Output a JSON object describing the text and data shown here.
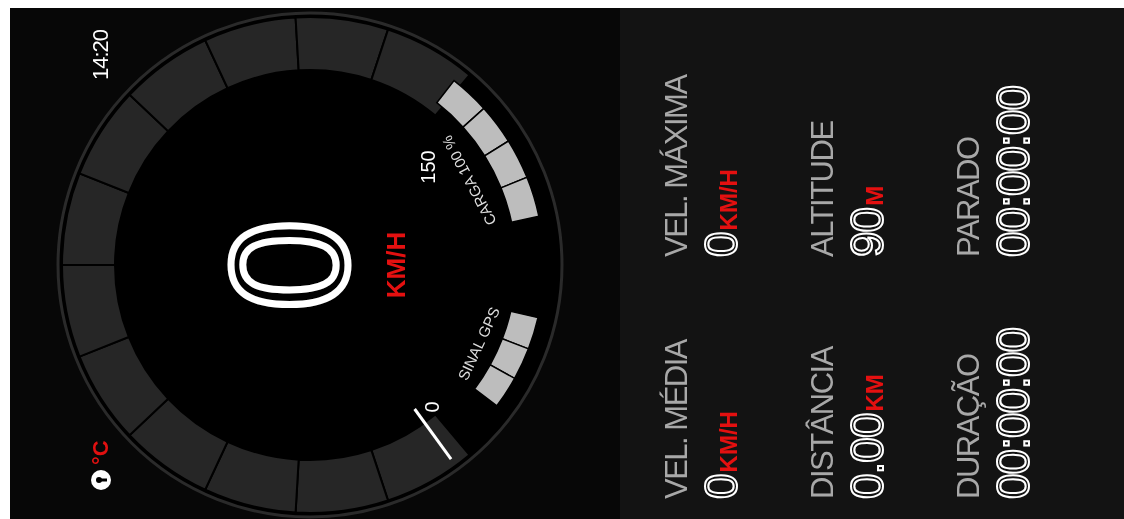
{
  "status_bar": {
    "temperature_unit": "°C",
    "time": "14:20"
  },
  "gauge": {
    "speed": "0",
    "unit": "KM/H",
    "scale_min": "0",
    "scale_max": "150",
    "indicators": [
      {
        "label": "CARGA 100 %"
      },
      {
        "label": "SINAL GPS"
      }
    ]
  },
  "stats": [
    {
      "label": "VEL. MÉDIA",
      "value": "0",
      "unit": "KM/H"
    },
    {
      "label": "VEL. MÁXIMA",
      "value": "0",
      "unit": "KM/H"
    },
    {
      "label": "DISTÂNCIA",
      "value": "0.00",
      "unit": "KM"
    },
    {
      "label": "ALTITUDE",
      "value": "90",
      "unit": "M"
    },
    {
      "label": "DURAÇÃO",
      "value": "00:00:00"
    },
    {
      "label": "PARADO",
      "value": "00:00:00"
    }
  ]
}
